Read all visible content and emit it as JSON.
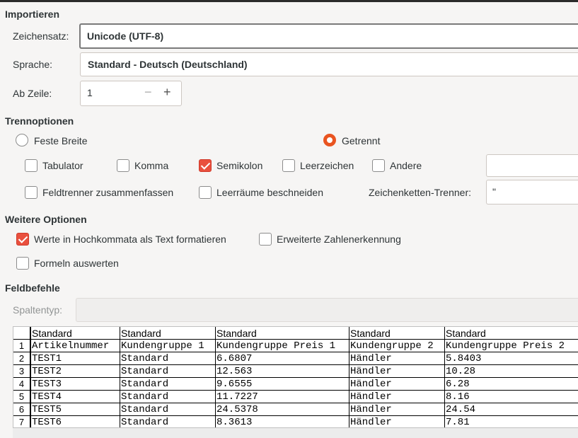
{
  "import": {
    "section_title": "Importieren",
    "charset_label": "Zeichensatz:",
    "charset_value": "Unicode (UTF-8)",
    "language_label": "Sprache:",
    "language_value": "Standard - Deutsch (Deutschland)",
    "from_row_label": "Ab Zeile:",
    "from_row_value": "1",
    "minus": "−",
    "plus": "+"
  },
  "separator": {
    "section_title": "Trennoptionen",
    "fixed_width_label": "Feste Breite",
    "fixed_width_selected": false,
    "separated_label": "Getrennt",
    "separated_selected": true,
    "tab_label": "Tabulator",
    "tab_checked": false,
    "comma_label": "Komma",
    "comma_checked": false,
    "semicolon_label": "Semikolon",
    "semicolon_checked": true,
    "space_label": "Leerzeichen",
    "space_checked": false,
    "other_label": "Andere",
    "other_checked": false,
    "other_value": "",
    "merge_label": "Feldtrenner zusammenfassen",
    "merge_checked": false,
    "trim_label": "Leerräume beschneiden",
    "trim_checked": false,
    "string_delim_label": "Zeichenketten-Trenner:",
    "string_delim_value": "\""
  },
  "other_options": {
    "section_title": "Weitere Optionen",
    "quoted_as_text_label": "Werte in Hochkommata als Text formatieren",
    "quoted_as_text_checked": true,
    "detect_numbers_label": "Erweiterte Zahlenerkennung",
    "detect_numbers_checked": false,
    "eval_formulas_label": "Formeln auswerten",
    "eval_formulas_checked": false
  },
  "fields": {
    "section_title": "Feldbefehle",
    "column_type_label": "Spaltentyp:"
  },
  "preview": {
    "headers": [
      "Standard",
      "Standard",
      "Standard",
      "Standard",
      "Standard"
    ],
    "rows": [
      {
        "n": "1",
        "cells": [
          "Artikelnummer",
          "Kundengruppe 1",
          "Kundengruppe Preis 1",
          "Kundengruppe 2",
          "Kundengruppe Preis 2"
        ]
      },
      {
        "n": "2",
        "cells": [
          "TEST1",
          "Standard",
          "6.6807",
          "Händler",
          "5.8403"
        ]
      },
      {
        "n": "3",
        "cells": [
          "TEST2",
          "Standard",
          "12.563",
          "Händler",
          "10.28"
        ]
      },
      {
        "n": "4",
        "cells": [
          "TEST3",
          "Standard",
          "9.6555",
          "Händler",
          "6.28"
        ]
      },
      {
        "n": "5",
        "cells": [
          "TEST4",
          "Standard",
          "11.7227",
          "Händler",
          "8.16"
        ]
      },
      {
        "n": "6",
        "cells": [
          "TEST5",
          "Standard",
          "24.5378",
          "Händler",
          "24.54"
        ]
      },
      {
        "n": "7",
        "cells": [
          "TEST6",
          "Standard",
          "8.3613",
          "Händler",
          "7.81"
        ]
      }
    ]
  },
  "colors": {
    "accent": "#e95420",
    "check_on": "#e9503e",
    "window_bg": "#f6f5f4"
  }
}
